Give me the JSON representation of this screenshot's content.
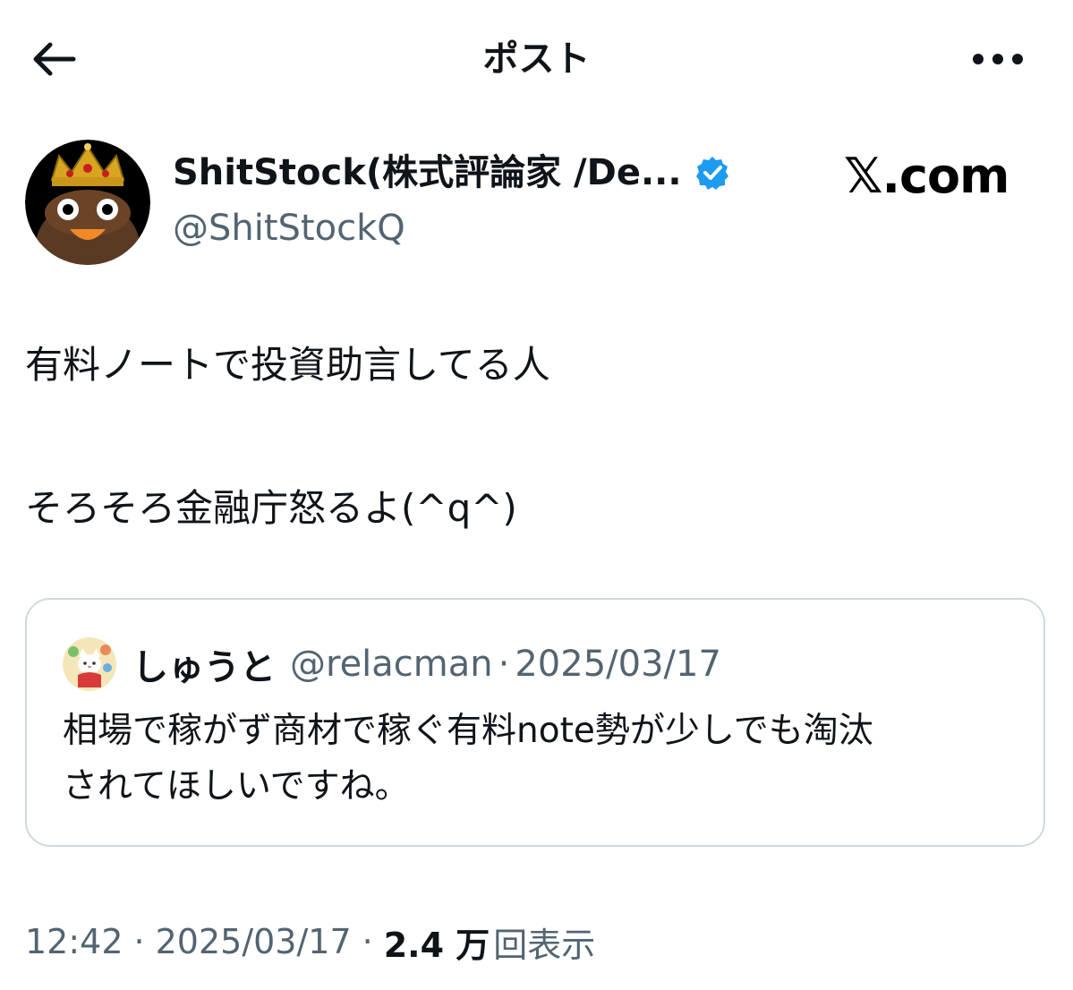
{
  "header": {
    "back_icon": "arrow-left-icon",
    "title": "ポスト",
    "more_icon": "more-horizontal-icon"
  },
  "author": {
    "display_name": "ShitStock(株式評論家 /De...",
    "handle": "@ShitStockQ",
    "verified": true,
    "verified_color": "#1d9bf0"
  },
  "watermark": {
    "text": "𝕏.com"
  },
  "post": {
    "lines": [
      "有料ノートで投資助言してる人",
      "そろそろ金融庁怒るよ(^q^)"
    ]
  },
  "quote": {
    "name": "しゅうと",
    "handle": "@relacman",
    "separator": "·",
    "date": "2025/03/17",
    "lines": [
      "相場で稼がず商材で稼ぐ有料note勢が少しでも淘汰",
      "されてほしいですね。"
    ]
  },
  "meta": {
    "time": "12:42",
    "separator": "·",
    "date": "2025/03/17",
    "views_count": "2.4 万",
    "views_label": "回表示"
  },
  "colors": {
    "text_primary": "#0f1419",
    "text_secondary": "#536471",
    "border": "#cfd9de",
    "accent": "#1d9bf0"
  }
}
